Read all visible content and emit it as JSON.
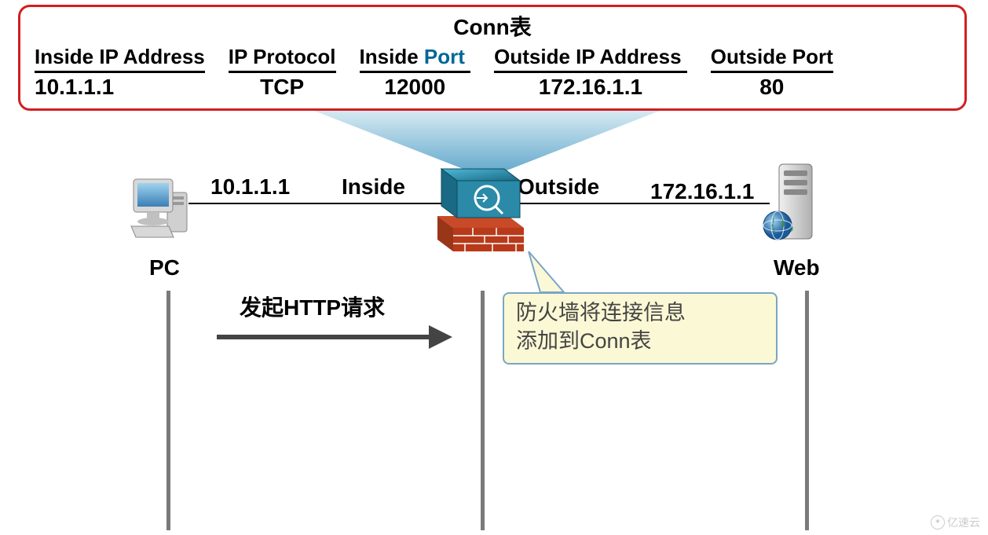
{
  "conn_table": {
    "title": "Conn表",
    "columns": [
      {
        "header": "Inside IP Address",
        "value": "10.1.1.1"
      },
      {
        "header": "IP Protocol",
        "value": "TCP"
      },
      {
        "header": "Inside Port",
        "value": "12000"
      },
      {
        "header": "Outside IP Address",
        "value": "172.16.1.1"
      },
      {
        "header": "Outside Port",
        "value": "80"
      }
    ]
  },
  "topology": {
    "left_ip": "10.1.1.1",
    "inside_label": "Inside",
    "outside_label": "Outside",
    "right_ip": "172.16.1.1",
    "pc_label": "PC",
    "web_label": "Web"
  },
  "http_request_label": "发起HTTP请求",
  "callout_line1": "防火墙将连接信息",
  "callout_line2": "添加到Conn表",
  "watermark": "亿速云",
  "icons": {
    "pc": "pc-icon",
    "firewall": "firewall-icon",
    "server": "web-server-icon",
    "globe": "globe-icon"
  },
  "colors": {
    "table_border": "#d21f1f",
    "port_text": "#006699",
    "callout_bg": "#fbf8d5",
    "callout_border": "#7aa5c7",
    "firewall_top": "#2a8aa8",
    "firewall_brick": "#b83a1a"
  }
}
